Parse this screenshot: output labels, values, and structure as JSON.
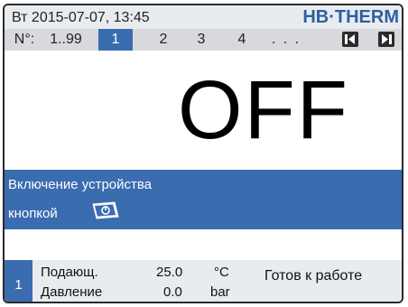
{
  "header": {
    "datetime": "Вт  2015-07-07, 13:45",
    "logo": "HB·THERM"
  },
  "unit_selector": {
    "prefix": "N°:",
    "range": "1..99",
    "units": [
      "1",
      "2",
      "3",
      "4"
    ],
    "selected": "1",
    "more": ". . ."
  },
  "status": {
    "main": "OFF",
    "message_line1": "Включение устройства",
    "message_line2": "кнопкой"
  },
  "bottom": {
    "unit_number": "1",
    "supply_label": "Подающ.",
    "supply_value": "25.0",
    "supply_unit": "°C",
    "pressure_label": "Давление",
    "pressure_value": "0.0",
    "pressure_unit": "bar",
    "ready_text": "Готов к работе"
  },
  "colors": {
    "accent": "#3a6cb0",
    "logo": "#2e5ea4",
    "topbar": "#e9ecef",
    "unitbar": "#d7d9dc"
  },
  "icons": {
    "nav_prev": "skip-back-icon",
    "nav_next": "skip-forward-icon",
    "power_key": "power-key-icon"
  }
}
